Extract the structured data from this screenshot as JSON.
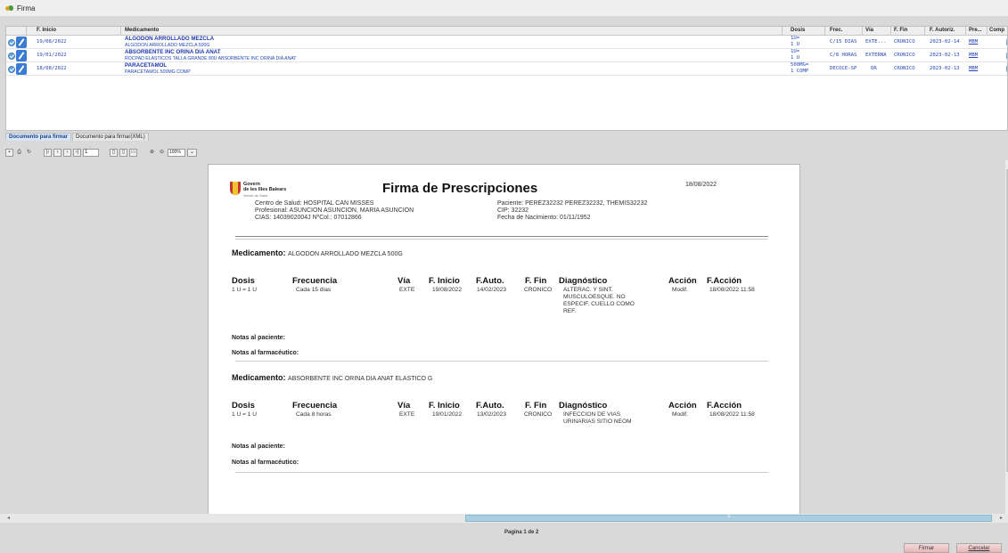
{
  "window": {
    "title": "Firma"
  },
  "grid": {
    "columns": [
      "F. Inicio",
      "Medicamento",
      "Dosis",
      "Frec.",
      "Vía",
      "F. Fin",
      "F. Autoriz.",
      "Pre...",
      "Comp"
    ],
    "rows": [
      {
        "f_inicio": "19/08/2022",
        "med_name": "ALGODON ARROLLADO MEZCLA",
        "med_detail": "ALGODON ARROLLADO MEZCLA 500G",
        "dosis1": "1U=",
        "dosis2": "1 U",
        "frec": "C/15 DIAS",
        "via": "EXTE...",
        "f_fin": "CRONICO",
        "f_autoriz": "2023-02-14",
        "pre": "MBM"
      },
      {
        "f_inicio": "19/01/2022",
        "med_name": "ABSORBENTE INC ORINA DIA ANAT",
        "med_detail": "ROCPAD ELASTICOS TALLA GRANDE 80U ABSORBENTE INC ORINA DIA ANAT",
        "dosis1": "1U=",
        "dosis2": "1 U",
        "frec": "C/8 HORAS",
        "via": "EXTERNA",
        "f_fin": "CRONICO",
        "f_autoriz": "2023-02-13",
        "pre": "MBM"
      },
      {
        "f_inicio": "18/08/2022",
        "med_name": "PARACETAMOL",
        "med_detail": "PARACETAMOL 500MG COMP",
        "dosis1": "500MG=",
        "dosis2": "1 COMP",
        "frec": "DECOCE-SP",
        "via": "OR",
        "f_fin": "CRONICO",
        "f_autoriz": "2023-02-13",
        "pre": "MBM"
      }
    ]
  },
  "tabs": [
    {
      "label": "Documento para firmar",
      "active": true
    },
    {
      "label": "Documento para firmar(XML)",
      "active": false
    }
  ],
  "toolbar": {
    "page_value": "1",
    "zoom_value": "100%"
  },
  "document": {
    "logo": {
      "line1": "Govern",
      "line2": "de les Illes Balears",
      "line3": "Servei de Salut"
    },
    "title": "Firma de Prescripciones",
    "date": "18/08/2022",
    "centro": "Centro de Salud: HOSPITAL CAN MISSES",
    "profesional": "Profesional: ASUNCION ASUNCION, MARIA ASUNCION",
    "cias": "CIAS: 1403902004J   NºCol.: 07012866",
    "paciente": "Paciente: PEREZ32232 PEREZ32232, THEMIS32232",
    "cip": "CIP: 32232",
    "nacimiento": "Fecha de Nacimiento: 01/11/1952",
    "med_label": "Medicamento:",
    "headers": {
      "dosis": "Dosis",
      "frecuencia": "Frecuencia",
      "via": "Vía",
      "f_inicio": "F. Inicio",
      "f_auto": "F.Auto.",
      "f_fin": "F. Fin",
      "diagnostico": "Diagnóstico",
      "accion": "Acción",
      "f_accion": "F.Acción"
    },
    "notas_paciente": "Notas al paciente:",
    "notas_farmaceutico": "Notas al farmacéutico:",
    "items": [
      {
        "medicamento": "ALGODON ARROLLADO MEZCLA 500G",
        "dosis": "1 U = 1 U",
        "frecuencia": "Cada 15 días",
        "via": "EXTE",
        "f_inicio": "19/08/2022",
        "f_auto": "14/02/2023",
        "f_fin": "CRONICO",
        "diag1": "ALTERAC. Y SINT.",
        "diag2": "MUSCULOESQUE. NO",
        "diag3": "ESPECIF. CUELLO COMO",
        "diag4": "REF.",
        "accion": "Modif.",
        "f_accion": "18/08/2022 11:58"
      },
      {
        "medicamento": "ABSORBENTE INC ORINA DIA ANAT ELASTICO G",
        "dosis": "1 U = 1 U",
        "frecuencia": "Cada 8 horas",
        "via": "EXTE",
        "f_inicio": "19/01/2022",
        "f_auto": "13/02/2023",
        "f_fin": "CRONICO",
        "diag1": "INFECCION DE VIAS",
        "diag2": "URINARIAS SITIO NEOM",
        "accion": "Modif.",
        "f_accion": "18/08/2022 11:58"
      }
    ]
  },
  "footer": {
    "page_indicator": "Pagina 1 de 2",
    "firmar": "Firmar",
    "cancelar": "Cancelar"
  },
  "colors": {
    "link_blue": "#2447b8",
    "tab_active": "#d6e6f5",
    "scroll_thumb": "#a9cfe0",
    "button_pink": "#e6b7b7"
  }
}
